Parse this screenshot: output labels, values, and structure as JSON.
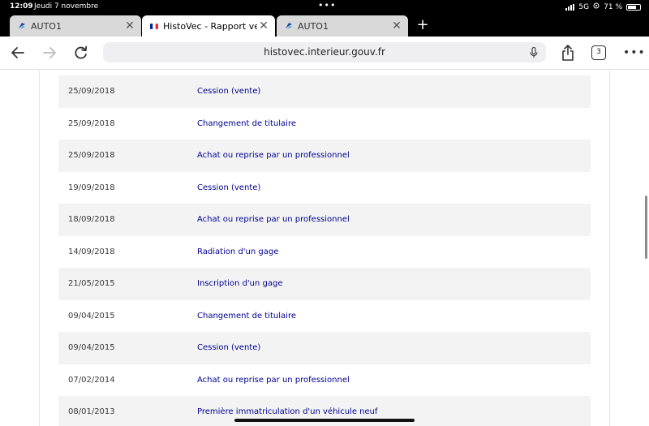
{
  "status_bar": {
    "time": "12:09",
    "date": "Jeudi 7 novembre",
    "network": "5G",
    "battery": "71 %",
    "battery_level": 0.71
  },
  "tabs": [
    {
      "title": "AUTO1",
      "favicon": "auto1-logo-icon",
      "active": false
    },
    {
      "title": "HistoVec - Rapport vendeur",
      "favicon": "french-flag-icon",
      "active": true
    },
    {
      "title": "AUTO1",
      "favicon": "auto1-logo-icon",
      "active": false
    }
  ],
  "toolbar": {
    "url": "histovec.interieur.gouv.fr",
    "tab_count": "3"
  },
  "history": {
    "rows": [
      {
        "date": "25/09/2018",
        "event": "Cession (vente)"
      },
      {
        "date": "25/09/2018",
        "event": "Changement de titulaire"
      },
      {
        "date": "25/09/2018",
        "event": "Achat ou reprise par un professionnel"
      },
      {
        "date": "19/09/2018",
        "event": "Cession (vente)"
      },
      {
        "date": "18/09/2018",
        "event": "Achat ou reprise par un professionnel"
      },
      {
        "date": "14/09/2018",
        "event": "Radiation d'un gage"
      },
      {
        "date": "21/05/2015",
        "event": "Inscription d'un gage"
      },
      {
        "date": "09/04/2015",
        "event": "Changement de titulaire"
      },
      {
        "date": "09/04/2015",
        "event": "Cession (vente)"
      },
      {
        "date": "07/02/2014",
        "event": "Achat ou reprise par un professionnel"
      },
      {
        "date": "08/01/2013",
        "event": "Première immatriculation d'un véhicule neuf"
      }
    ]
  },
  "colors": {
    "event_link": "#000091",
    "row_shade": "#f3f3f3"
  }
}
